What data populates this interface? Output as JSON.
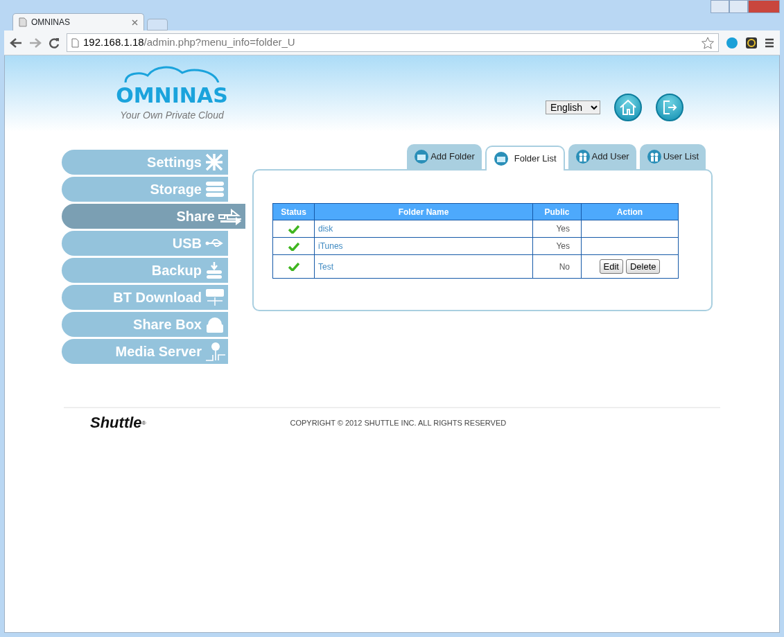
{
  "browser": {
    "tab_title": "OMNINAS",
    "url_host": "192.168.1.18",
    "url_path": "/admin.php?menu_info=folder_U"
  },
  "header": {
    "logo": "OMNINAS",
    "tagline": "Your Own Private Cloud",
    "language": "English"
  },
  "sidebar": [
    {
      "label": "Settings",
      "selected": false
    },
    {
      "label": "Storage",
      "selected": false
    },
    {
      "label": "Share",
      "selected": true
    },
    {
      "label": "USB",
      "selected": false
    },
    {
      "label": "Backup",
      "selected": false
    },
    {
      "label": "BT Download",
      "selected": false
    },
    {
      "label": "Share Box",
      "selected": false
    },
    {
      "label": "Media Server",
      "selected": false
    }
  ],
  "tabs": [
    {
      "label": "Add Folder",
      "selected": false
    },
    {
      "label": "Folder List",
      "selected": true
    },
    {
      "label": "Add User",
      "selected": false
    },
    {
      "label": "User List",
      "selected": false
    }
  ],
  "table": {
    "columns": [
      "Status",
      "Folder Name",
      "Public",
      "Action"
    ],
    "rows": [
      {
        "active": true,
        "name": "disk",
        "public": "Yes",
        "actions": []
      },
      {
        "active": true,
        "name": "iTunes",
        "public": "Yes",
        "actions": []
      },
      {
        "active": true,
        "name": "Test",
        "public": "No",
        "actions": [
          "Edit",
          "Delete"
        ]
      }
    ]
  },
  "footer": {
    "brand": "Shuttle",
    "brand_mark": "®",
    "copyright": "COPYRIGHT © 2012 SHUTTLE INC. ALL RIGHTS RESERVED"
  }
}
